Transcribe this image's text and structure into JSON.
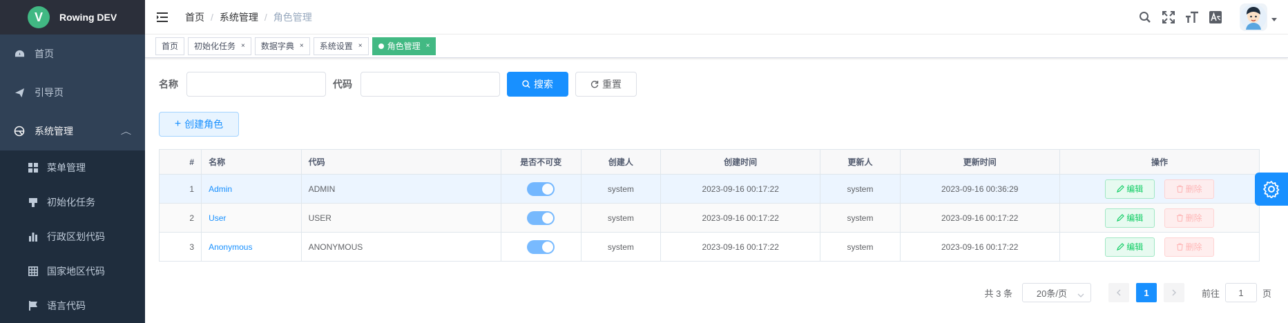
{
  "app": {
    "title": "Rowing DEV",
    "logo_letter": "V"
  },
  "sidebar": {
    "items": [
      {
        "label": "首页",
        "icon": "dashboard-icon"
      },
      {
        "label": "引导页",
        "icon": "guide-icon"
      },
      {
        "label": "系统管理",
        "icon": "system-icon",
        "expanded": true
      }
    ],
    "submenu": [
      {
        "label": "菜单管理",
        "icon": "menu-grid-icon"
      },
      {
        "label": "初始化任务",
        "icon": "task-icon"
      },
      {
        "label": "行政区划代码",
        "icon": "bar-chart-icon"
      },
      {
        "label": "国家地区代码",
        "icon": "table-icon"
      },
      {
        "label": "语言代码",
        "icon": "flag-icon"
      }
    ]
  },
  "breadcrumb": [
    "首页",
    "系统管理",
    "角色管理"
  ],
  "tags": [
    {
      "label": "首页",
      "closable": false
    },
    {
      "label": "初始化任务",
      "closable": true
    },
    {
      "label": "数据字典",
      "closable": true
    },
    {
      "label": "系统设置",
      "closable": true
    },
    {
      "label": "角色管理",
      "closable": true,
      "active": true
    }
  ],
  "search": {
    "name_label": "名称",
    "code_label": "代码",
    "name_value": "",
    "code_value": "",
    "search_button": "搜索",
    "reset_button": "重置"
  },
  "toolbar": {
    "create_button": "创建角色"
  },
  "table": {
    "columns": [
      "#",
      "名称",
      "代码",
      "是否不可变",
      "创建人",
      "创建时间",
      "更新人",
      "更新时间",
      "操作"
    ],
    "rows": [
      {
        "index": "1",
        "name": "Admin",
        "code": "ADMIN",
        "immutable": true,
        "creator": "system",
        "created": "2023-09-16 00:17:22",
        "updater": "system",
        "updated": "2023-09-16 00:36:29"
      },
      {
        "index": "2",
        "name": "User",
        "code": "USER",
        "immutable": true,
        "creator": "system",
        "created": "2023-09-16 00:17:22",
        "updater": "system",
        "updated": "2023-09-16 00:17:22"
      },
      {
        "index": "3",
        "name": "Anonymous",
        "code": "ANONYMOUS",
        "immutable": true,
        "creator": "system",
        "created": "2023-09-16 00:17:22",
        "updater": "system",
        "updated": "2023-09-16 00:17:22"
      }
    ],
    "edit_label": "编辑",
    "delete_label": "删除"
  },
  "pagination": {
    "total_text": "共 3 条",
    "page_size": "20条/页",
    "current_page": "1",
    "goto_prefix": "前往",
    "goto_value": "1",
    "goto_suffix": "页"
  },
  "colors": {
    "primary": "#1890ff",
    "sidebar": "#304156",
    "active_tag": "#42b983",
    "success": "#13ce66",
    "danger": "#ff4949"
  }
}
